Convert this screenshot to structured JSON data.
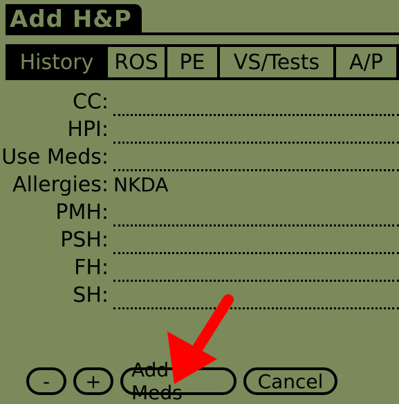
{
  "title": "Add H&P",
  "tabs": [
    {
      "label": "History",
      "active": true
    },
    {
      "label": "ROS",
      "active": false
    },
    {
      "label": "PE",
      "active": false
    },
    {
      "label": "VS/Tests",
      "active": false
    },
    {
      "label": "A/P",
      "active": false
    }
  ],
  "fields": [
    {
      "label": "CC:",
      "value": ""
    },
    {
      "label": "HPI:",
      "value": ""
    },
    {
      "label": "Use Meds:",
      "value": ""
    },
    {
      "label": "Allergies:",
      "value": "NKDA"
    },
    {
      "label": "PMH:",
      "value": ""
    },
    {
      "label": "PSH:",
      "value": ""
    },
    {
      "label": "FH:",
      "value": ""
    },
    {
      "label": "SH:",
      "value": ""
    }
  ],
  "buttons": {
    "minus": "-",
    "plus": "+",
    "add_meds": "Add Meds",
    "cancel": "Cancel"
  },
  "colors": {
    "screen_background": "#7a8a5b",
    "foreground": "#000000",
    "annotation_arrow": "#ff0000"
  },
  "icons": {
    "annotation": "red-arrow-icon"
  }
}
